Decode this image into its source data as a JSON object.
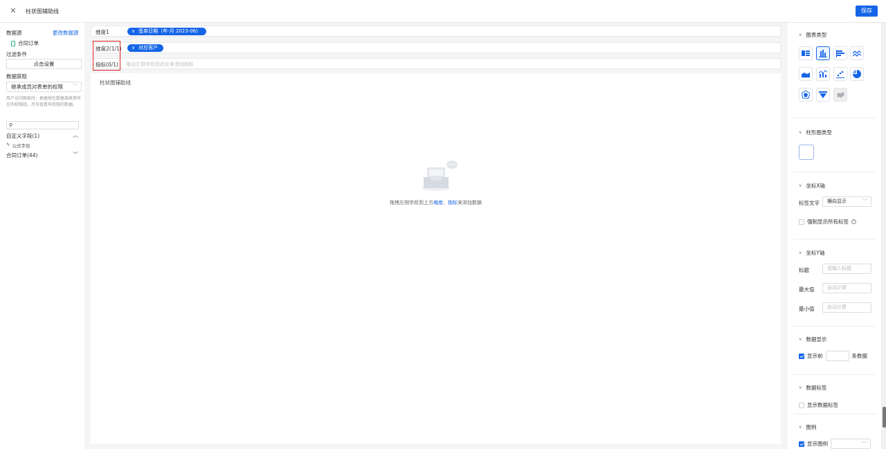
{
  "topbar": {
    "title": "柱状图辅助线",
    "save_label": "保存"
  },
  "left": {
    "datasource_label": "数据源",
    "change_datasource": "更改数据源",
    "datasource_item": "合同订单",
    "filter_label": "过滤条件",
    "filter_button": "点击设置",
    "fetch_label": "数据获取",
    "permission_value": "继承成员对表单的权限",
    "permission_desc": "用户访问图表时，根据他在数据源表单所在的权限组，尽可查看有权限的数据。",
    "custom_fields": "自定义字段(1)",
    "formula_field": "公式字段",
    "contract_fields": "合同订单(44)"
  },
  "center": {
    "dim1_label": "维度1",
    "dim1_pill": "签单日期（年-月 2023-06）",
    "dim2_label": "维度2(1/1)",
    "dim2_pill": "对应客户",
    "metric_label": "指标(0/1)",
    "metric_placeholder": "拖动左侧字段到此处来添加指标",
    "chart_title": "柱状图辅助线",
    "empty_pre": "拖拽左侧字段到上方",
    "empty_dim": "维度",
    "empty_sep": "、",
    "empty_metric": "指标",
    "empty_post": "来添加数据"
  },
  "right": {
    "chart_type": "图表类型",
    "bar_type": "柱形图类型",
    "x_axis": "坐标X轴",
    "label_text": "标签文字",
    "label_text_value": "横向显示",
    "force_show": "强制显示所有标签",
    "y_axis": "坐标Y轴",
    "y_title": "标题",
    "y_title_placeholder": "请输入标题",
    "y_max": "最大值",
    "y_max_placeholder": "自动计算",
    "y_min": "最小值",
    "y_min_placeholder": "自动计算",
    "data_display": "数据显示",
    "show_first": "显示前",
    "records": "条数据",
    "data_label": "数据标签",
    "show_data_label": "显示数据标签",
    "legend": "图例",
    "show_legend": "显示图例"
  },
  "colors": {
    "accent": "#1565e8",
    "highlight_box": "#e02020"
  }
}
